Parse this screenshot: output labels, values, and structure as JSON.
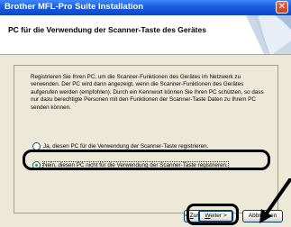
{
  "window": {
    "title": "Brother MFL-Pro Suite Installation",
    "close_glyph": "✕"
  },
  "header": {
    "title": "PC für die Verwendung der Scanner-Taste des Gerätes"
  },
  "description": "Registrieren Sie Ihren PC, um die Scanner-Funktionen des Gerätes im Netzwerk zu verwenden. Der PC wird dann angezeigt, wenn die Scanner-Funktionen des Gerätes aufgerufen werden (empfohlen). Durch ein Kennwort können Sie Ihren PC schützen, so dass nur dazu berechtigte Personen mit den Funktionen der Scanner-Taste Daten zu Ihrem PC senden können.",
  "options": [
    {
      "label": "Ja, diesen PC für die Verwendung der Scanner-Taste registrieren.",
      "selected": false
    },
    {
      "label": "Nein, diesen PC nicht für die Verwendung der Scanner-Taste registrieren.",
      "selected": true
    }
  ],
  "buttons": {
    "back": {
      "prefix": "< ",
      "underlined": "Z",
      "rest": "urück"
    },
    "next": {
      "underlined": "W",
      "rest": "eiter >"
    },
    "cancel": "Abbrechen"
  },
  "colors": {
    "titlebar": "#0a46c8",
    "dialog_background": "#ece9d8",
    "highlight": "#000000"
  }
}
